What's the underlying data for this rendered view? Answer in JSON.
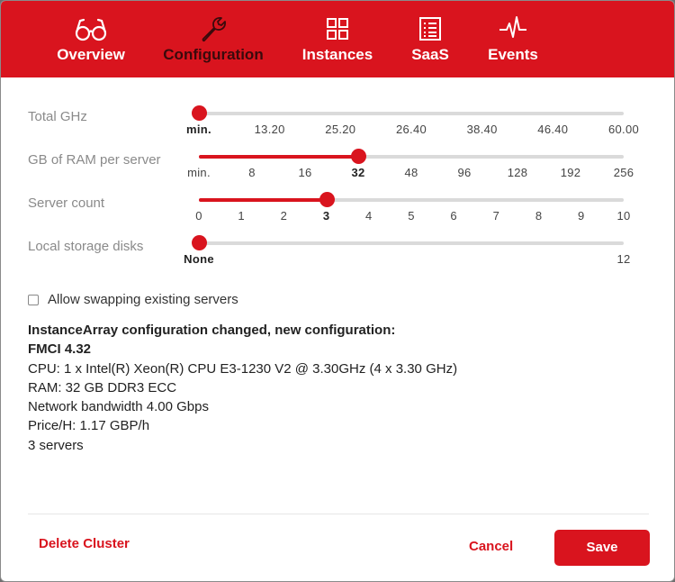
{
  "tabs": [
    {
      "label": "Overview",
      "icon": "glasses-icon",
      "active": false
    },
    {
      "label": "Configuration",
      "icon": "wrench-icon",
      "active": true
    },
    {
      "label": "Instances",
      "icon": "grid-icon",
      "active": false
    },
    {
      "label": "SaaS",
      "icon": "list-icon",
      "active": false
    },
    {
      "label": "Events",
      "icon": "pulse-icon",
      "active": false
    }
  ],
  "sliders": {
    "total_ghz": {
      "label": "Total GHz",
      "ticks": [
        "min.",
        "13.20",
        "25.20",
        "26.40",
        "38.40",
        "46.40",
        "60.00"
      ],
      "selected_index": 0
    },
    "ram": {
      "label": "GB of RAM per server",
      "ticks": [
        "min.",
        "8",
        "16",
        "32",
        "48",
        "96",
        "128",
        "192",
        "256"
      ],
      "selected_index": 3
    },
    "server_count": {
      "label": "Server count",
      "ticks": [
        "0",
        "1",
        "2",
        "3",
        "4",
        "5",
        "6",
        "7",
        "8",
        "9",
        "10"
      ],
      "selected_index": 3
    },
    "storage": {
      "label": "Local storage disks",
      "ticks": [
        "None",
        "12"
      ],
      "selected_index": 0
    }
  },
  "allow_swapping": {
    "label": "Allow swapping existing servers",
    "checked": false
  },
  "summary": {
    "heading": "InstanceArray configuration changed, new configuration:",
    "instance_type": "FMCI 4.32",
    "cpu": "CPU: 1 x Intel(R) Xeon(R) CPU E3-1230 V2 @ 3.30GHz (4 x 3.30 GHz)",
    "ram": "RAM: 32 GB DDR3 ECC",
    "bandwidth": "Network bandwidth 4.00 Gbps",
    "price": "Price/H: 1.17 GBP/h",
    "servers": "3 servers"
  },
  "footer": {
    "delete_label": "Delete Cluster",
    "cancel_label": "Cancel",
    "save_label": "Save"
  },
  "colors": {
    "accent": "#d9141e",
    "active_tab_text": "#3a0a0c"
  }
}
